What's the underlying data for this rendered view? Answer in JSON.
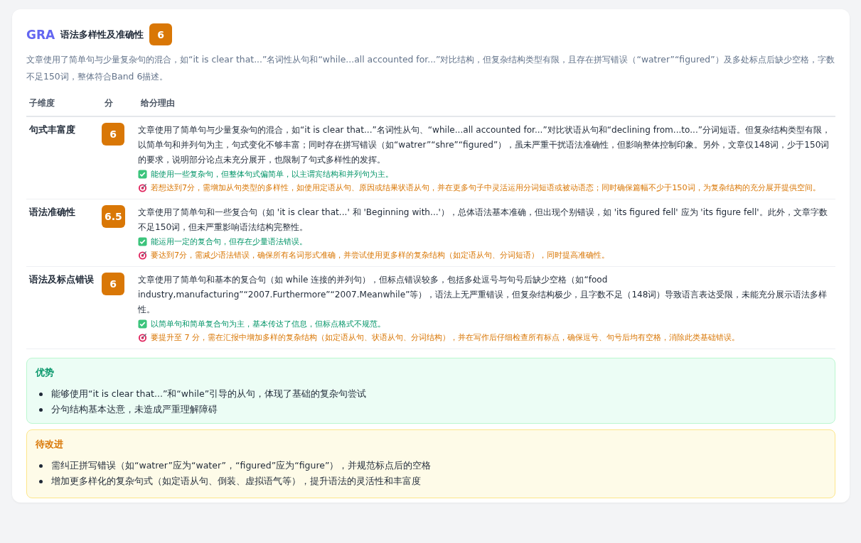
{
  "header": {
    "code": "GRA",
    "title": "语法多样性及准确性",
    "score": "6"
  },
  "summary": "文章使用了简单句与少量复杂句的混合，如“it is clear that...”名词性从句和“while...all accounted for...”对比结构，但复杂结构类型有限，且存在拼写错误（“watrer”“figured”）及多处标点后缺少空格，字数不足150词，整体符合Band 6描述。",
  "table": {
    "columns": [
      "子维度",
      "分",
      "给分理由"
    ],
    "rows": [
      {
        "name": "句式丰富度",
        "score": "6",
        "reason": "文章使用了简单句与少量复杂句的混合，如“it is clear that...”名词性从句、“while...all accounted for...”对比状语从句和“declining from...to...”分词短语。但复杂结构类型有限，以简单句和并列句为主，句式变化不够丰富；同时存在拼写错误（如“watrer”“shre”“figured”），虽未严重干扰语法准确性，但影响整体控制印象。另外，文章仅148词，少于150词的要求，说明部分论点未充分展开，也限制了句式多样性的发挥。",
        "positive": "能使用一些复杂句，但整体句式偏简单，以主谓宾结构和并列句为主。",
        "advice": "若想达到7分，需增加从句类型的多样性，如使用定语从句、原因或结果状语从句，并在更多句子中灵活运用分词短语或被动语态；同时确保篇幅不少于150词，为复杂结构的充分展开提供空间。"
      },
      {
        "name": "语法准确性",
        "score": "6.5",
        "reason": "文章使用了简单句和一些复合句（如 'it is clear that...' 和 'Beginning with...'），总体语法基本准确，但出现个别错误，如 'its figured fell' 应为 'its figure fell'。此外，文章字数不足150词，但未严重影响语法结构完整性。",
        "positive": "能运用一定的复合句，但存在少量语法错误。",
        "advice": "要达到7分，需减少语法错误，确保所有名词形式准确，并尝试使用更多样的复杂结构（如定语从句、分词短语），同时提高准确性。"
      },
      {
        "name": "语法及标点错误",
        "score": "6",
        "reason": "文章使用了简单句和基本的复合句（如 while 连接的并列句），但标点错误较多，包括多处逗号与句号后缺少空格（如“food industry,manufacturing”“2007.Furthermore”“2007.Meanwhile”等），语法上无严重错误，但复杂结构极少，且字数不足（148词）导致语言表达受限，未能充分展示语法多样性。",
        "positive": "以简单句和简单复合句为主，基本传达了信息，但标点格式不规范。",
        "advice": "要提升至 7 分，需在汇报中增加多样的复杂结构（如定语从句、状语从句、分词结构），并在写作后仔细检查所有标点，确保逗号、句号后均有空格，消除此类基础错误。"
      }
    ]
  },
  "panels": [
    {
      "kind": "strengths",
      "title": "优势",
      "items": [
        "能够使用“it is clear that...”和“while”引导的从句，体现了基础的复杂句尝试",
        "分句结构基本达意，未造成严重理解障碍"
      ]
    },
    {
      "kind": "improvements",
      "title": "待改进",
      "items": [
        "需纠正拼写错误（如“watrer”应为“water”，“figured”应为“figure”），并规范标点后的空格",
        "增加更多样化的复杂句式（如定语从句、倒装、虚拟语气等），提升语法的灵活性和丰富度"
      ]
    }
  ]
}
